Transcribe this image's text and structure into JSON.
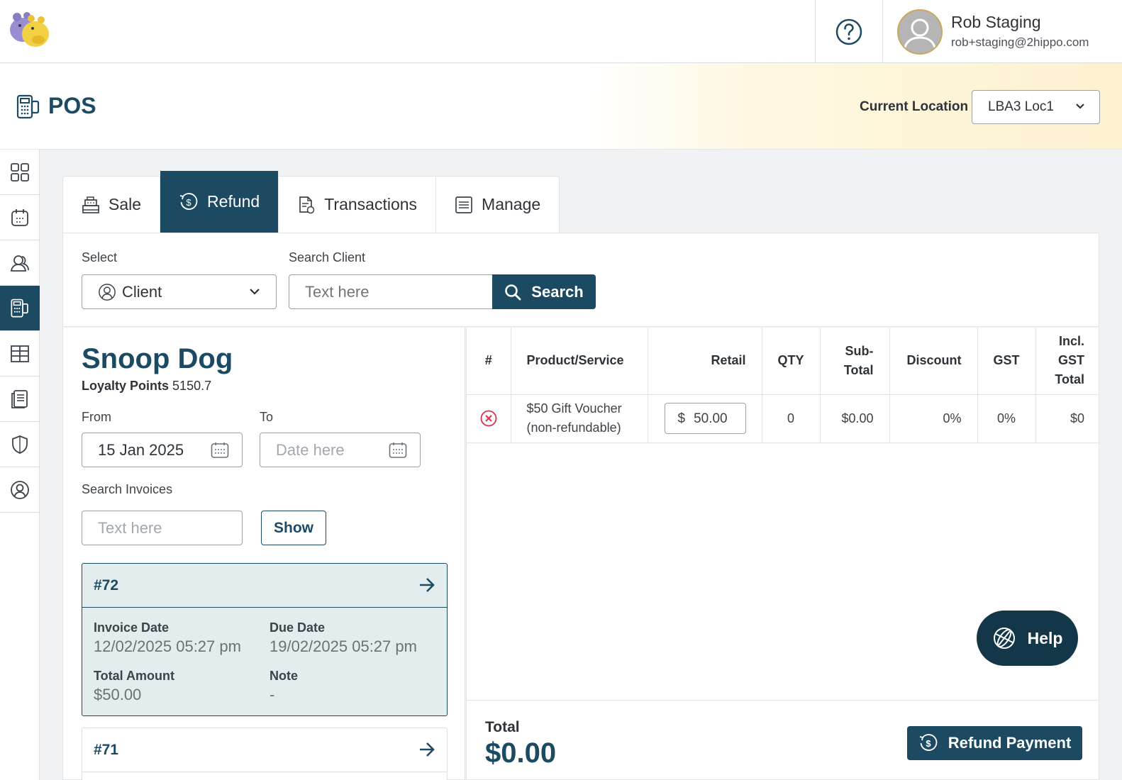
{
  "user": {
    "name": "Rob Staging",
    "email": "rob+staging@2hippo.com"
  },
  "header": {
    "title": "POS",
    "location_label": "Current Location",
    "location_value": "LBA3 Loc1"
  },
  "tabs": [
    {
      "label": "Sale",
      "icon": "cash-register-icon"
    },
    {
      "label": "Refund",
      "icon": "refund-icon",
      "active": true
    },
    {
      "label": "Transactions",
      "icon": "receipt-icon"
    },
    {
      "label": "Manage",
      "icon": "list-icon"
    }
  ],
  "search": {
    "select_label": "Select",
    "select_value": "Client",
    "search_label": "Search Client",
    "search_placeholder": "Text here",
    "search_button": "Search"
  },
  "client": {
    "name": "Snoop Dog",
    "loyalty_label": "Loyalty Points",
    "loyalty_value": "5150.7",
    "from_label": "From",
    "from_value": "15 Jan 2025",
    "to_label": "To",
    "to_placeholder": "Date here",
    "invoice_search_label": "Search Invoices",
    "invoice_search_placeholder": "Text here",
    "show_button": "Show"
  },
  "invoices": [
    {
      "number": "#72",
      "invoice_date_label": "Invoice Date",
      "invoice_date": "12/02/2025 05:27 pm",
      "due_date_label": "Due Date",
      "due_date": "19/02/2025 05:27 pm",
      "total_label": "Total Amount",
      "total": "$50.00",
      "note_label": "Note",
      "note": "-"
    },
    {
      "number": "#71"
    }
  ],
  "cart": {
    "headers": {
      "num": "#",
      "product": "Product/Service",
      "retail": "Retail",
      "qty": "QTY",
      "subtotal": "Sub-Total",
      "discount": "Discount",
      "gst": "GST",
      "total": "Incl. GST Total"
    },
    "rows": [
      {
        "product": "$50 Gift Voucher (non-refundable)",
        "currency": "$",
        "retail": "50.00",
        "qty": "0",
        "subtotal": "$0.00",
        "discount": "0%",
        "gst": "0%",
        "total": "$0"
      }
    ],
    "total_label": "Total",
    "total_value": "$0.00",
    "refund_button": "Refund Payment",
    "help_button": "Help"
  },
  "colors": {
    "primary": "#1d4a63",
    "danger": "#d9344f",
    "selected_card": "#e3eded"
  }
}
